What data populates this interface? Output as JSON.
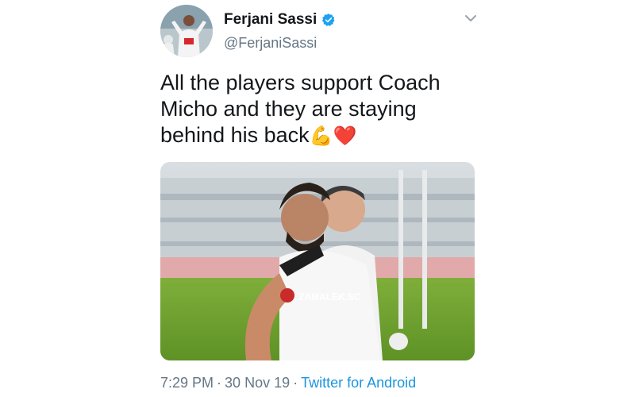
{
  "tweet": {
    "author": {
      "display_name": "Ferjani Sassi",
      "handle": "@FerjaniSassi",
      "verified": true,
      "verified_color": "#1da1f2"
    },
    "text_line": "All the players support Coach Micho and they are staying behind his back",
    "text_emojis": [
      "💪",
      "❤️"
    ],
    "media": {
      "watermark": "ZAMALEK.SC"
    },
    "meta": {
      "time": "7:29 PM",
      "date": "30 Nov 19",
      "separator": "·",
      "source": "Twitter for Android",
      "link_color": "#1b95e0"
    }
  },
  "icons": {
    "verified": "verified-badge-icon",
    "menu": "chevron-down-icon"
  }
}
